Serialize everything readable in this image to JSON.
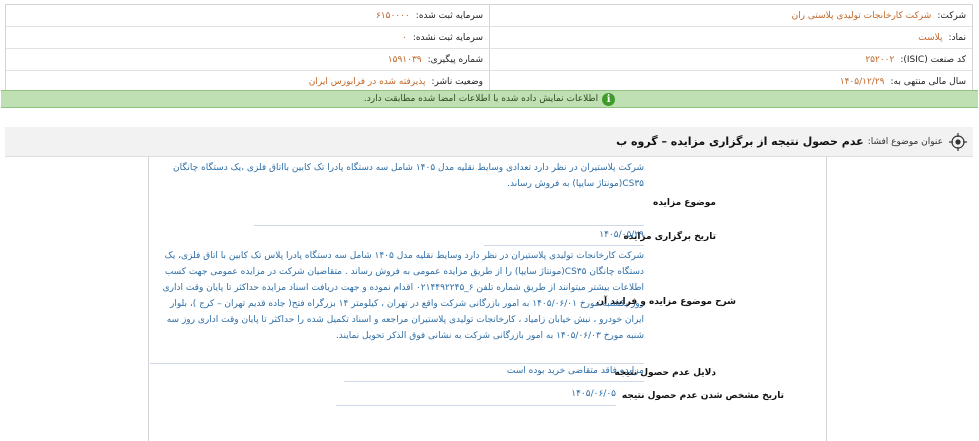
{
  "info": {
    "company_label": "شرکت:",
    "company_value": "شرکت کارخانجات تولیدی پلاستی ران",
    "registered_capital_label": "سرمایه ثبت شده:",
    "registered_capital_value": "۶۱۵۰۰۰۰",
    "symbol_label": "نماد:",
    "symbol_value": "پلاست",
    "unregistered_capital_label": "سرمایه ثبت نشده:",
    "unregistered_capital_value": "۰",
    "isic_label": "کد صنعت (ISIC):",
    "isic_value": "۲۵۲۰۰۲",
    "tracking_label": "شماره پیگیری:",
    "tracking_value": "۱۵۹۱۰۳۹",
    "fiscal_year_label": "سال مالی منتهی به:",
    "fiscal_year_value": "۱۴۰۵/۱۲/۲۹",
    "publisher_status_label": "وضعیت ناشر:",
    "publisher_status_value": "پذیرفته شده در فرابورس ایران"
  },
  "notice": {
    "icon": "info-icon",
    "icon_glyph": "i",
    "text": "اطلاعات نمایش داده شده با اطلاعات امضا شده مطابقت دارد."
  },
  "subject": {
    "icon": "target-icon",
    "label": "عنوان موضوع افشا:",
    "title": "عدم حصول نتیجه از برگزاری مزایده – گروه ب"
  },
  "fields": {
    "auction_subject_label": "موضوع مزایده",
    "auction_subject_value": "شرکت پلاستیران در نظر دارد تعدادی وسایط نقلیه مدل ۱۴۰۵ شامل سه دستگاه پادرا تک کابین بااتاق فلزی ،یک دستگاه چانگان CS۳۵(مونتاژ سایپا) به فروش رساند.",
    "auction_date_label": "تاریخ برگزاری مزایده",
    "auction_date_value": "۱۴۰۵/۰۵/۲۹",
    "process_label": "شرح موضوع مزایده و فرایند آن",
    "process_value": "شرکت کارخانجات تولیدی پلاستیران در نظر دارد وسایط نقلیه مدل ۱۴۰۵ شامل سه دستگاه پادرا پلاس تک کابین با اتاق فلزی، یک دستگاه چانگان CS۳۵(مونتاژ سایپا) را از طریق مزایده عمومی به فروش رساند . متقاضیان شرکت در مزایده عمومی جهت کسب اطلاعات بیشتر میتوانند از طریق شماره تلفن ۶_۰۲۱۴۴۹۲۲۴۵ اقدام نموده و جهت دریافت اسناد مزایده حداکثر تا پایان وقت اداری روز یکشنبه مورخ ۱۴۰۵/۰۶/۰۱ به امور بازرگانی شرکت واقع در تهران ، کیلومتر ۱۴ بزرگراه فتح( جاده قدیم تهران – کرج )، بلوار ایران خودرو ، نبش خیابان زامیاد ، کارخانجات تولیدی پلاستیران مراجعه و اسناد تکمیل شده را حداکثر تا پایان وقت اداری روز سه شنبه مورخ ۱۴۰۵/۰۶/۰۳ به امور بازرگانی شرکت به نشانی فوق الذکر تحویل نمایند.",
    "failure_reason_label": "دلایل عدم حصول نتیجه",
    "failure_reason_value": "مزایده فاقد متقاضی خرید بوده است",
    "failure_date_label": "تاریخ مشخص شدن عدم حصول نتیجه",
    "failure_date_value": "۱۴۰۵/۰۶/۰۵"
  },
  "colors": {
    "value_orange": "#c0672a",
    "value_blue": "#2e6ea6",
    "notice_green": "#bfe0b3"
  }
}
